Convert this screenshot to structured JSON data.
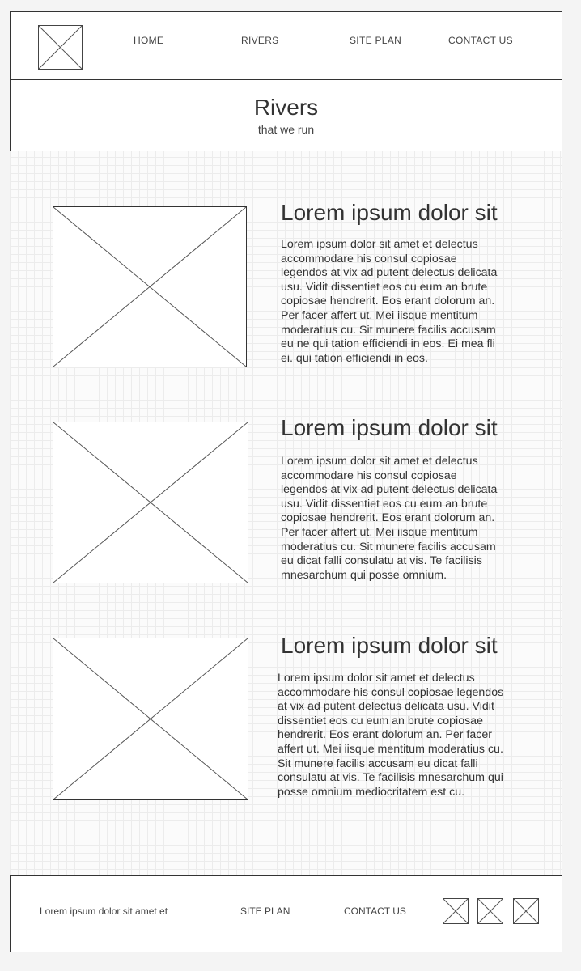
{
  "header": {
    "logo_icon": "image-placeholder-icon",
    "nav": [
      {
        "label": "HOME"
      },
      {
        "label": "RIVERS"
      },
      {
        "label": "SITE PLAN"
      },
      {
        "label": "CONTACT US"
      }
    ]
  },
  "hero": {
    "title": "Rivers",
    "subtitle": "that we run"
  },
  "articles": [
    {
      "image_icon": "image-placeholder-icon",
      "title": "Lorem ipsum dolor sit",
      "lines": [
        "Lorem ipsum dolor sit amet et delectus",
        "accommodare his consul copiosae",
        "legendos at vix ad putent delectus delicata",
        "usu. Vidit dissentiet eos cu eum an brute",
        "copiosae hendrerit. Eos erant dolorum an.",
        "Per facer affert ut. Mei iisque mentitum",
        "moderatius cu. Sit munere facilis accusam",
        "eu ne qui tation efficiendi in eos. Ei mea fli",
        "ei. qui tation efficiendi in eos."
      ]
    },
    {
      "image_icon": "image-placeholder-icon",
      "title": "Lorem ipsum dolor sit",
      "lines": [
        "Lorem ipsum dolor sit amet et delectus",
        "accommodare his consul copiosae",
        "legendos at vix ad putent delectus delicata",
        "usu. Vidit dissentiet eos cu eum an brute",
        "copiosae hendrerit. Eos erant dolorum an.",
        "Per facer affert ut. Mei iisque mentitum",
        "moderatius cu. Sit munere facilis accusam",
        "eu dicat falli consulatu at vis. Te facilisis",
        "mnesarchum qui posse omnium."
      ]
    },
    {
      "image_icon": "image-placeholder-icon",
      "title": "Lorem ipsum dolor sit",
      "lines": [
        "Lorem ipsum dolor sit amet et delectus",
        "accommodare his consul copiosae legendos",
        "at vix ad putent delectus delicata usu. Vidit",
        "dissentiet eos cu eum an brute copiosae",
        "hendrerit. Eos erant dolorum an. Per facer",
        "affert ut. Mei iisque mentitum moderatius cu.",
        "Sit munere facilis accusam eu dicat falli",
        "consulatu at vis. Te facilisis mnesarchum qui",
        "posse omnium mediocritatem est cu."
      ]
    }
  ],
  "footer": {
    "text": "Lorem ipsum dolor sit amet et",
    "site_plan": "SITE PLAN",
    "contact_us": "CONTACT US",
    "social_icons": [
      "image-placeholder-icon",
      "image-placeholder-icon",
      "image-placeholder-icon"
    ]
  }
}
